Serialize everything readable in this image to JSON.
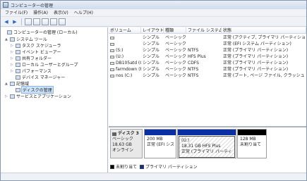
{
  "window": {
    "title": "コンピューターの管理"
  },
  "menu": [
    "ファイル(F)",
    "操作(A)",
    "表示(V)",
    "ヘルプ(H)"
  ],
  "tree": [
    {
      "label": "コンピューターの管理 (ローカル)",
      "level": 0,
      "expander": ""
    },
    {
      "label": "システム ツール",
      "level": 1,
      "expander": "▲"
    },
    {
      "label": "タスク スケジューラ",
      "level": 2,
      "expander": "▷"
    },
    {
      "label": "イベント ビューアー",
      "level": 2,
      "expander": "▷"
    },
    {
      "label": "共有フォルダー",
      "level": 2,
      "expander": "▷"
    },
    {
      "label": "ローカル ユーザーとグループ",
      "level": 2,
      "expander": "▷"
    },
    {
      "label": "パフォーマンス",
      "level": 2,
      "expander": "▷"
    },
    {
      "label": "デバイス マネージャー",
      "level": 2,
      "expander": ""
    },
    {
      "label": "記憶域",
      "level": 1,
      "expander": "▲"
    },
    {
      "label": "ディスクの管理",
      "level": 2,
      "expander": "",
      "selected": true
    },
    {
      "label": "サービスとアプリケーション",
      "level": 1,
      "expander": "▷"
    }
  ],
  "volume_table": {
    "headers": [
      "ボリューム",
      "レイアウト",
      "種類",
      "ファイル システム",
      "状態"
    ],
    "rows": [
      [
        "",
        "シンプル",
        "ベーシック",
        "",
        "正常 (アクティブ, プライマリ パーティション"
      ],
      [
        "",
        "シンプル",
        "ベーシック",
        "",
        "正常 (EFI システム パーティション)"
      ],
      [
        "(S:)",
        "シンプル",
        "ベーシック",
        "NTFS",
        "正常 (プライマリ パーティション)"
      ],
      [
        "(U:)",
        "シンプル",
        "ベーシック",
        "HFS Plus",
        "正常 (プライマリ パーティション)"
      ],
      [
        "DB105atd (G:)",
        "シンプル",
        "ベーシック",
        "CDFS",
        "正常 (プライマリ パーティション)"
      ],
      [
        "farmdown (F:)",
        "シンプル",
        "ベーシック",
        "NTFS",
        "正常 (プライマリ パーティション)"
      ],
      [
        "nos (C:)",
        "シンプル",
        "ベーシック",
        "NTFS",
        "正常 (ブート, ページ ファイル, クラッシュ ダ"
      ]
    ]
  },
  "disk": {
    "name": "ディスク 3",
    "type": "ベーシック",
    "size": "18.63 GB",
    "status": "オンライン",
    "partitions": [
      {
        "title": "",
        "size": "200 MB",
        "status": "正常 (EFI シス",
        "bar": "blue"
      },
      {
        "title": "(U:)",
        "size": "18.31 GB HFS Plus",
        "status": "正常 (プライマリ パーティショ",
        "bar": "blue",
        "selected": true
      },
      {
        "title": "",
        "size": "128 MB",
        "status": "未割り当て",
        "bar": "black"
      }
    ]
  },
  "legend": {
    "unallocated": "未割り当て",
    "primary": "プライマリ パーティション"
  },
  "colors": {
    "primary_partition": "#0a2ea3",
    "unallocated": "#000000",
    "selection": "#cde3fb"
  }
}
